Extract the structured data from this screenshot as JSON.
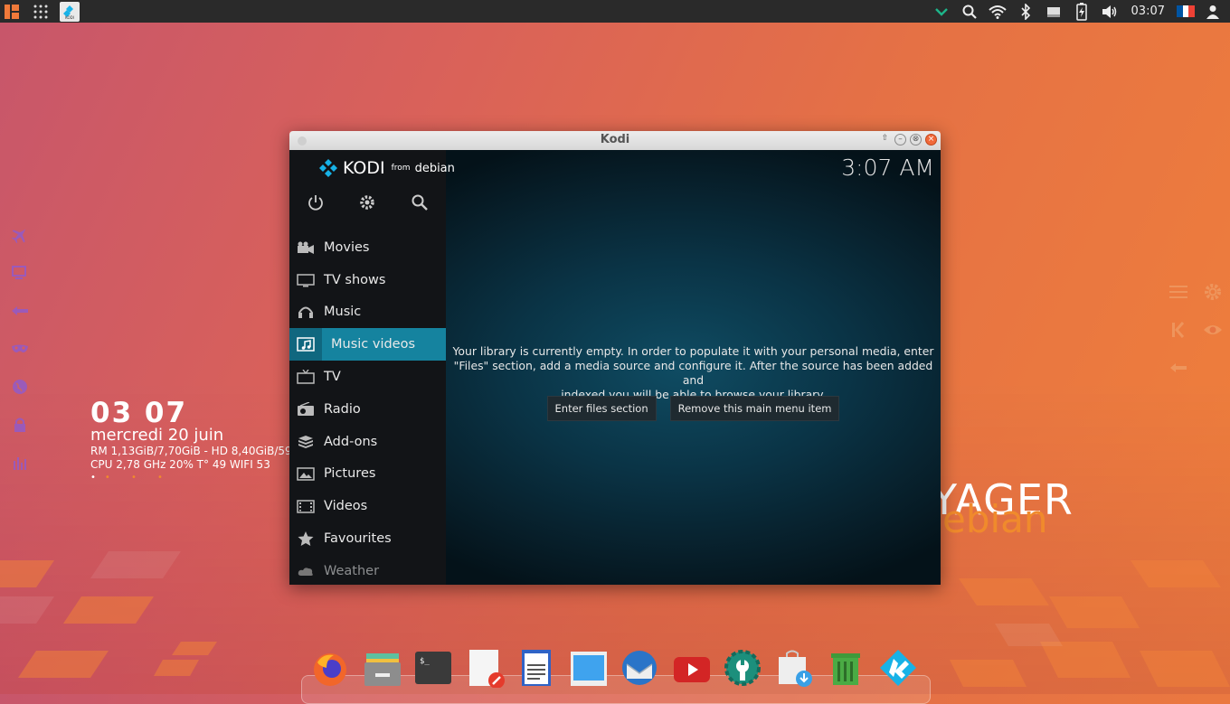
{
  "topbar": {
    "clock": "03:07",
    "icons": [
      "menu-icon",
      "apps-grid-icon",
      "kodi-task-icon",
      "chevron-down-icon",
      "search-icon",
      "wifi-icon",
      "bluetooth-icon",
      "drive-icon",
      "battery-icon",
      "volume-icon",
      "flag-fr-icon",
      "user-icon"
    ],
    "kodi_task_label": "KODI"
  },
  "conky": {
    "time": "03 07",
    "date": "mercredi 20 juin",
    "mem": "RM 1,13GiB/7,70GiB - HD 8,40GiB/59",
    "cpu": "CPU 2,78 GHz 20% T° 49  WIFI 53",
    "dots": "• • • •"
  },
  "brand": {
    "line1": "YAGER",
    "line2": "ebian"
  },
  "window": {
    "title": "Kodi"
  },
  "kodi": {
    "logo_name": "KODI",
    "logo_from": "from",
    "logo_debian": "debian",
    "clock": "3:07 AM",
    "menu": [
      {
        "label": "Movies",
        "icon": "movie-camera-icon"
      },
      {
        "label": "TV shows",
        "icon": "tv-screen-icon"
      },
      {
        "label": "Music",
        "icon": "headphones-icon"
      },
      {
        "label": "Music videos",
        "icon": "music-video-icon",
        "active": true
      },
      {
        "label": "TV",
        "icon": "tv-icon"
      },
      {
        "label": "Radio",
        "icon": "radio-icon"
      },
      {
        "label": "Add-ons",
        "icon": "addons-box-icon"
      },
      {
        "label": "Pictures",
        "icon": "picture-icon"
      },
      {
        "label": "Videos",
        "icon": "film-icon"
      },
      {
        "label": "Favourites",
        "icon": "star-icon"
      },
      {
        "label": "Weather",
        "icon": "weather-icon"
      }
    ],
    "empty_line1": "Your library is currently empty. In order to populate it with your personal media, enter",
    "empty_line2": "\"Files\" section, add a media source and configure it. After the source has been added and",
    "empty_line3": "indexed you will be able to browse your library.",
    "btn_files": "Enter files section",
    "btn_remove": "Remove this main menu item"
  },
  "colors": {
    "accent": "#15839f",
    "panel": "#2a2a2a",
    "sidebar": "#121417",
    "brand_orange": "#f08a2c"
  },
  "dock": [
    "firefox-icon",
    "file-manager-icon",
    "terminal-icon",
    "text-editor-icon",
    "writer-document-icon",
    "window-icon",
    "thunderbird-icon",
    "youtube-icon",
    "settings-wrench-icon",
    "software-install-icon",
    "trash-icon",
    "kodi-icon"
  ]
}
